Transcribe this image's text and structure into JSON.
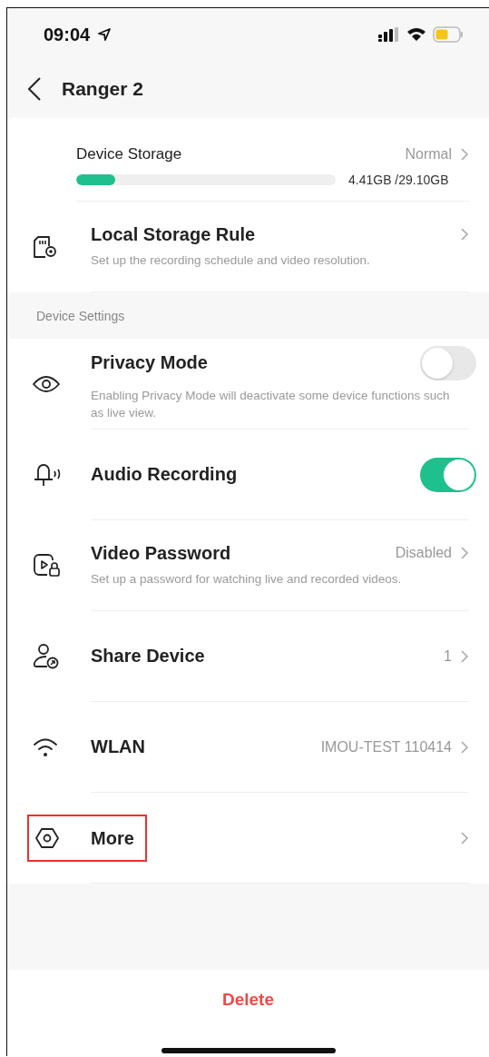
{
  "status_bar": {
    "time": "09:04"
  },
  "nav": {
    "title": "Ranger 2"
  },
  "storage": {
    "label": "Device Storage",
    "status": "Normal",
    "level": 0.15,
    "reading": "4.41GB /29.10GB"
  },
  "storage_rule": {
    "title": "Local Storage Rule",
    "subtitle": "Set up the recording schedule and video resolution."
  },
  "section": {
    "title": "Device Settings"
  },
  "items": [
    {
      "kind": "toggle",
      "title": "Privacy Mode",
      "subtitle": "Enabling Privacy Mode will deactivate some device functions such as live view.",
      "on": false
    },
    {
      "kind": "toggle",
      "title": "Audio Recording",
      "on": true
    },
    {
      "kind": "link",
      "title": "Video Password",
      "value": "Disabled",
      "subtitle": "Set up a password for watching live and recorded videos."
    },
    {
      "kind": "link",
      "title": "Share Device",
      "value": "1"
    },
    {
      "kind": "link",
      "title": "WLAN",
      "value": "IMOU-TEST 110414"
    },
    {
      "kind": "link",
      "title": "More",
      "highlighted": true
    }
  ],
  "delete_button": {
    "label": "Delete"
  }
}
